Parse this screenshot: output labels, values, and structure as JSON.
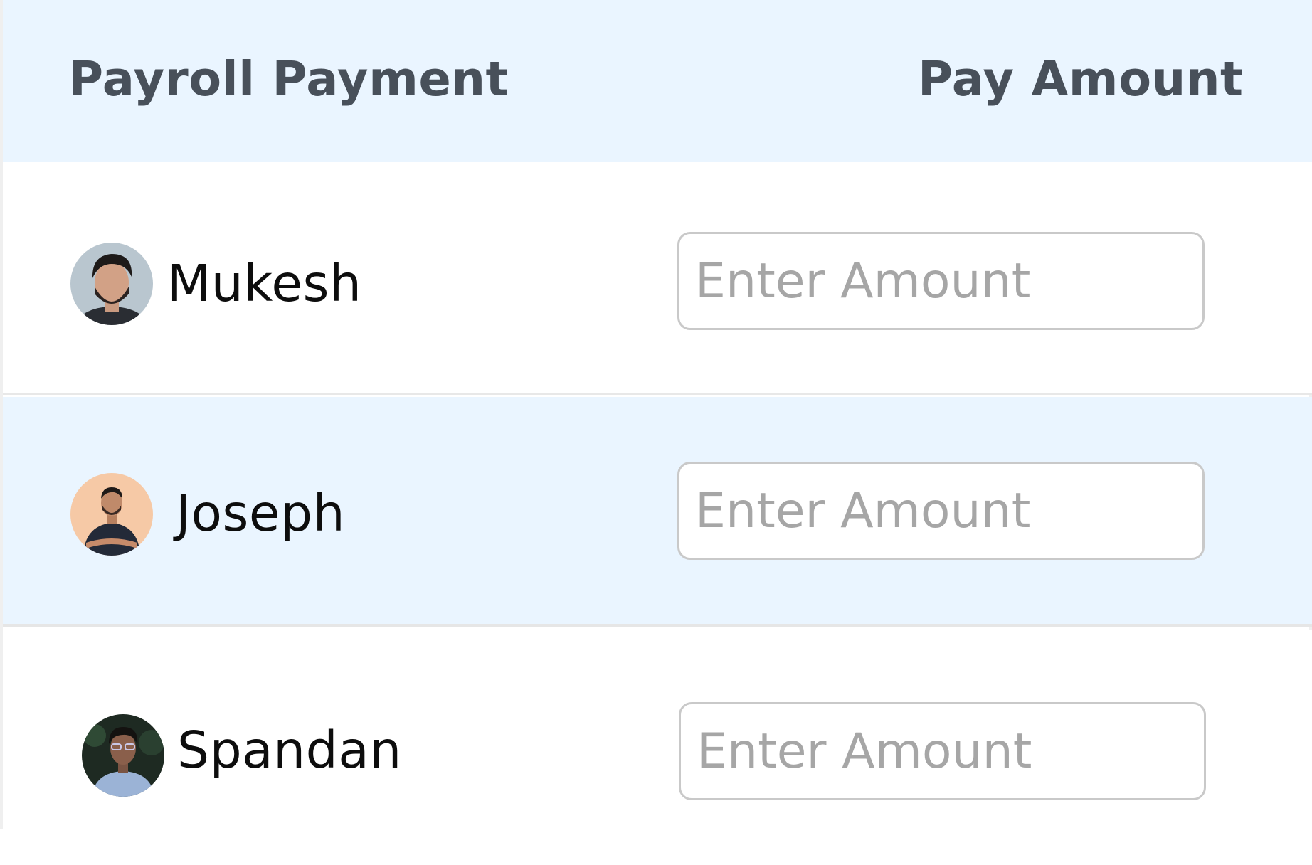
{
  "header": {
    "left_label": "Payroll Payment",
    "right_label": "Pay Amount"
  },
  "rows": [
    {
      "name": "Mukesh",
      "avatar": "avatar-photo-bearded-man",
      "amount_placeholder": "Enter Amount",
      "amount_value": ""
    },
    {
      "name": "Joseph",
      "avatar": "avatar-photo-smiling-man",
      "amount_placeholder": "Enter Amount",
      "amount_value": ""
    },
    {
      "name": "Spandan",
      "avatar": "avatar-photo-man-glasses",
      "amount_placeholder": "Enter Amount",
      "amount_value": ""
    }
  ],
  "colors": {
    "header_bg": "#eaf5ff",
    "alt_row_bg": "#eaf5ff",
    "header_text": "#48505a",
    "input_border": "#c9c9c9",
    "placeholder_text": "#a6a6a6"
  }
}
